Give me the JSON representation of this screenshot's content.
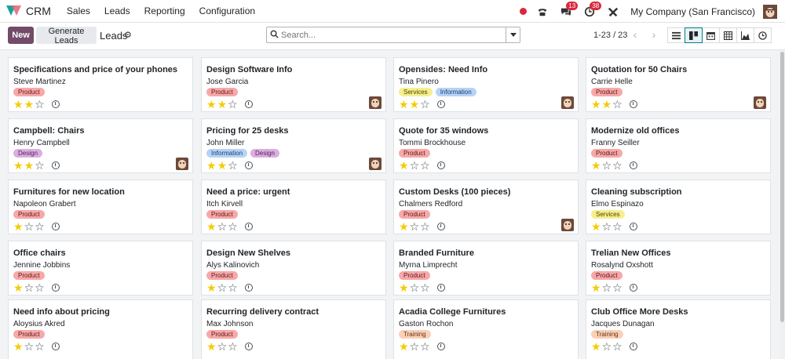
{
  "app": {
    "name": "CRM"
  },
  "menu": [
    {
      "label": "Sales"
    },
    {
      "label": "Leads"
    },
    {
      "label": "Reporting"
    },
    {
      "label": "Configuration"
    }
  ],
  "systray": {
    "discuss_badge": "13",
    "activity_badge": "38",
    "company": "My Company (San Francisco)"
  },
  "control_panel": {
    "new_label": "New",
    "generate_label": "Generate Leads",
    "breadcrumb": "Leads",
    "search_placeholder": "Search...",
    "pager": "1-23 / 23"
  },
  "colors": {
    "brand": "#714b67",
    "accent": "#017e84",
    "star_on": "#f3cc00"
  },
  "tag_styles": {
    "Product": {
      "bg": "#f7a8a8",
      "fg": "#5c1a1a"
    },
    "Services": {
      "bg": "#f6ef8e",
      "fg": "#4a4300"
    },
    "Information": {
      "bg": "#b6d3f7",
      "fg": "#163e6b"
    },
    "Design": {
      "bg": "#dcaee0",
      "fg": "#4c1f52"
    },
    "Training": {
      "bg": "#f9d1b8",
      "fg": "#6a2d0e"
    }
  },
  "leads": [
    {
      "title": "Specifications and price of your phones",
      "contact": "Steve Martinez",
      "tags": [
        "Product"
      ],
      "stars": 2,
      "avatar": false
    },
    {
      "title": "Design Software Info",
      "contact": "Jose Garcia",
      "tags": [
        "Product"
      ],
      "stars": 2,
      "avatar": true
    },
    {
      "title": "Opensides: Need Info",
      "contact": "Tina Pinero",
      "tags": [
        "Services",
        "Information"
      ],
      "stars": 2,
      "avatar": true
    },
    {
      "title": "Quotation for 50 Chairs",
      "contact": "Carrie Helle",
      "tags": [
        "Product"
      ],
      "stars": 2,
      "avatar": true
    },
    {
      "title": "Campbell: Chairs",
      "contact": "Henry Campbell",
      "tags": [
        "Design"
      ],
      "stars": 2,
      "avatar": true
    },
    {
      "title": "Pricing for 25 desks",
      "contact": "John Miller",
      "tags": [
        "Information",
        "Design"
      ],
      "stars": 2,
      "avatar": true
    },
    {
      "title": "Quote for 35 windows",
      "contact": "Tommi Brockhouse",
      "tags": [
        "Product"
      ],
      "stars": 1,
      "avatar": false
    },
    {
      "title": "Modernize old offices",
      "contact": "Franny Seiller",
      "tags": [
        "Product"
      ],
      "stars": 1,
      "avatar": false
    },
    {
      "title": "Furnitures for new location",
      "contact": "Napoleon Grabert",
      "tags": [
        "Product"
      ],
      "stars": 1,
      "avatar": false
    },
    {
      "title": "Need a price: urgent",
      "contact": "Itch Kirvell",
      "tags": [
        "Product"
      ],
      "stars": 1,
      "avatar": false
    },
    {
      "title": "Custom Desks (100 pieces)",
      "contact": "Chalmers Redford",
      "tags": [
        "Product"
      ],
      "stars": 1,
      "avatar": true
    },
    {
      "title": "Cleaning subscription",
      "contact": "Elmo Espinazo",
      "tags": [
        "Services"
      ],
      "stars": 1,
      "avatar": false
    },
    {
      "title": "Office chairs",
      "contact": "Jennine Jobbins",
      "tags": [
        "Product"
      ],
      "stars": 1,
      "avatar": false
    },
    {
      "title": "Design New Shelves",
      "contact": "Alys Kalinovich",
      "tags": [
        "Product"
      ],
      "stars": 1,
      "avatar": false
    },
    {
      "title": "Branded Furniture",
      "contact": "Myrna Limprecht",
      "tags": [
        "Product"
      ],
      "stars": 1,
      "avatar": false
    },
    {
      "title": "Trelian New Offices",
      "contact": "Rosalynd Oxshott",
      "tags": [
        "Product"
      ],
      "stars": 1,
      "avatar": false
    },
    {
      "title": "Need info about pricing",
      "contact": "Aloysius Akred",
      "tags": [
        "Product"
      ],
      "stars": 1,
      "avatar": false
    },
    {
      "title": "Recurring delivery contract",
      "contact": "Max Johnson",
      "tags": [
        "Product"
      ],
      "stars": 1,
      "avatar": false
    },
    {
      "title": "Acadia College Furnitures",
      "contact": "Gaston Rochon",
      "tags": [
        "Training"
      ],
      "stars": 1,
      "avatar": false
    },
    {
      "title": "Club Office More Desks",
      "contact": "Jacques Dunagan",
      "tags": [
        "Training"
      ],
      "stars": 1,
      "avatar": false
    }
  ]
}
